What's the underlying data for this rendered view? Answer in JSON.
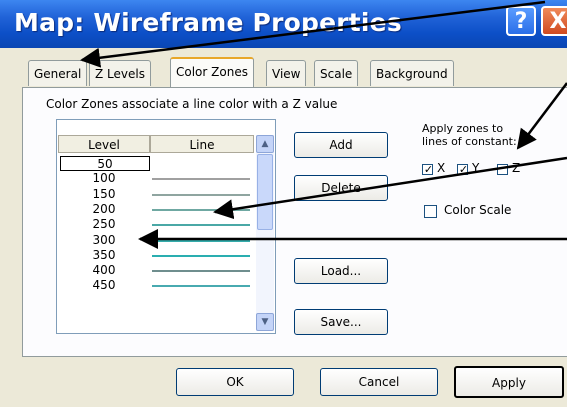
{
  "window": {
    "title": "Map: Wireframe Properties",
    "help_glyph": "?",
    "close_glyph": "X"
  },
  "tabs": [
    {
      "label": "General"
    },
    {
      "label": "Z Levels"
    },
    {
      "label": "Color Zones"
    },
    {
      "label": "View"
    },
    {
      "label": "Scale"
    },
    {
      "label": "Background"
    }
  ],
  "panel": {
    "description": "Color Zones associate a line color with a Z value",
    "columns": {
      "level": "Level",
      "line": "Line"
    },
    "rows": [
      {
        "level": "50",
        "color": "#c8c8c8"
      },
      {
        "level": "100",
        "color": "#a0a0a0"
      },
      {
        "level": "150",
        "color": "#8fa5a0"
      },
      {
        "level": "200",
        "color": "#6fa8a2"
      },
      {
        "level": "250",
        "color": "#4aa8a6"
      },
      {
        "level": "300",
        "color": "#35acab"
      },
      {
        "level": "350",
        "color": "#2aaeb0"
      },
      {
        "level": "400",
        "color": "#6f8e8e"
      },
      {
        "level": "450",
        "color": "#48aab0"
      }
    ],
    "buttons": {
      "add": "Add",
      "delete": "Delete",
      "load": "Load...",
      "save": "Save..."
    },
    "apply_label": "Apply zones to lines of constant:",
    "axes": [
      {
        "label": "X",
        "checked": true
      },
      {
        "label": "Y",
        "checked": true
      },
      {
        "label": "Z",
        "checked": false
      }
    ],
    "color_scale_label": "Color Scale"
  },
  "footer": {
    "ok": "OK",
    "cancel": "Cancel",
    "apply": "Apply"
  },
  "colors": {
    "title_blue": "#0c4fc7",
    "tab_highlight": "#e8a72a",
    "arrow": "#000000"
  }
}
